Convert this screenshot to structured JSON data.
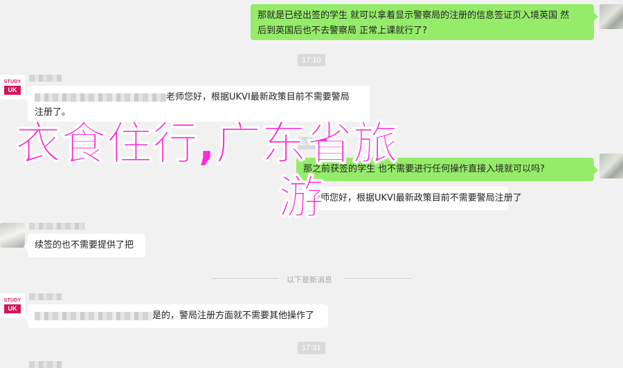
{
  "messages": [
    {
      "side": "right",
      "lines": [
        "那就是已经出签的学生 就可以拿着显示警察局的注册的信息签证页入境英国 然",
        "后到英国后也不去警察局 正常上课就行了?"
      ]
    },
    {
      "side": "left",
      "avatar": "STUDY UK",
      "lines": [
        "老师您好，根据UKVI最新政策目前不需要警局",
        "注册了。"
      ]
    },
    {
      "side": "right",
      "lines": [
        "那之前获签的学生 也不需要进行任何操作直接入境就可以吗?"
      ]
    },
    {
      "side": "left",
      "avatar": "",
      "lines": [
        "老师您好，根据UKVI最新政策目前不需要警局注册了"
      ]
    },
    {
      "side": "left",
      "avatar": "",
      "lines": [
        "续签的也不需要提供了把"
      ]
    },
    {
      "side": "left",
      "avatar": "STUDY UK",
      "lines": [
        "是的，警局注册方面就不需要其他操作了"
      ]
    }
  ],
  "timestamps": [
    "17:10",
    "17:10",
    "17:31"
  ],
  "divider": "以下是新消息",
  "overlay": {
    "line1": "衣食住行,广东省旅",
    "line2": "游"
  },
  "avatar_labels": {
    "top": "STUDY",
    "bottom": "UK"
  },
  "colors": {
    "green_bubble": "#95ec69",
    "white_bubble": "#ffffff",
    "overlay": "#ff2bd4",
    "studyuk": "#d4145a"
  }
}
